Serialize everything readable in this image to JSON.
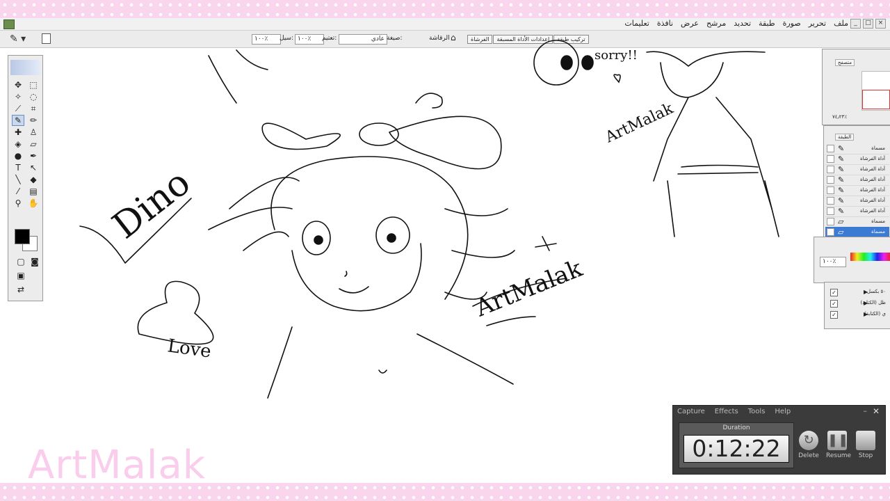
{
  "menubar": {
    "items": [
      "ملف",
      "تحرير",
      "صورة",
      "طبقة",
      "تحديد",
      "مرشح",
      "عرض",
      "نافذة",
      "تعليمات"
    ],
    "window_controls": [
      "_",
      "□",
      "×"
    ]
  },
  "options_bar": {
    "size_label": "الرقاشة",
    "mode_label": "صيغة:",
    "mode_value": "عادي",
    "opacity_label": "تعتيم:",
    "opacity_value": "١٠٠٪",
    "flow_label": "سيل:",
    "flow_value": "١٠٠٪",
    "tabs": [
      "الفرشاة",
      "إعدادات الأداة المسبقة",
      "تركيب طبقة"
    ]
  },
  "navigator": {
    "tab": "متصفح",
    "zoom": "٧٤٫٢٣٪"
  },
  "layers": {
    "tab": "الطبقة",
    "items": [
      "مسماة",
      "أداة الفرشاة",
      "أداة الفرشاة",
      "أداة الفرشاة",
      "أداة الفرشاة",
      "أداة الفرشاة",
      "أداة الفرشاة",
      "مسماة",
      "مسماة"
    ]
  },
  "color_panel": {
    "value": "١٠٠٪"
  },
  "actions": {
    "items": [
      "٥٠ بكسل",
      "ظل (الكتابة)",
      "ي (الكتابة)"
    ]
  },
  "canvas_text": {
    "dino": "Dino",
    "love": "Love",
    "sorry": "sorry!!",
    "artmalak_main": "ArtMalak",
    "artmalak_small": "ArtMalak"
  },
  "watermark": "ArtMalak",
  "recorder": {
    "menu": [
      "Capture",
      "Effects",
      "Tools",
      "Help"
    ],
    "duration_label": "Duration",
    "duration": "0:12:22",
    "buttons": [
      "Delete",
      "Resume",
      "Stop"
    ]
  }
}
